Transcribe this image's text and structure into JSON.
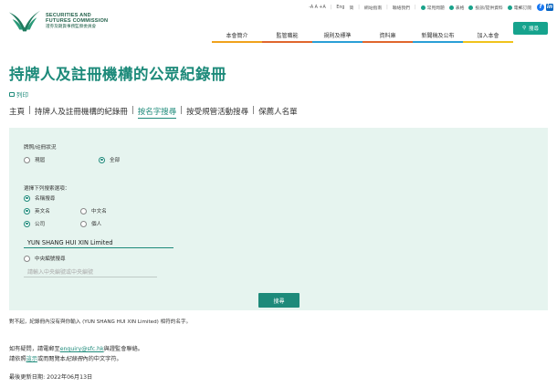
{
  "logo": {
    "en_line1": "SECURITIES AND",
    "en_line2": "FUTURES COMMISSION",
    "zh": "證券及期貨事務監察委員會"
  },
  "utility": {
    "font_sizes": "-A A +A",
    "lang_en": "Eng",
    "lang_sc": "简",
    "sitemap": "網站指南",
    "contact": "聯絡我們",
    "faq": "常見問題",
    "forms": "表格",
    "complaint": "投訴/提供資料",
    "subscribe": "電郵訂閱",
    "social_fb": "f",
    "social_li": "in"
  },
  "search_button": "搜尋",
  "nav": [
    {
      "label": "本會簡介",
      "color": "#f0a21c"
    },
    {
      "label": "監管職能",
      "color": "#e0662d"
    },
    {
      "label": "規則及標準",
      "color": "#2a9fd6"
    },
    {
      "label": "資料庫",
      "color": "#e0662d"
    },
    {
      "label": "新聞稿及公布",
      "color": "#2a9fd6"
    },
    {
      "label": "加入本會",
      "color": "#f0c31c"
    }
  ],
  "page_title": "持牌人及註冊機構的公眾紀錄冊",
  "print_label": "列印",
  "tabs": [
    {
      "label": "主頁"
    },
    {
      "label": "持牌人及註冊機構的紀錄冊"
    },
    {
      "label": "按名字搜尋"
    },
    {
      "label": "按受規管活動搜尋"
    },
    {
      "label": "保薦人名單"
    }
  ],
  "form": {
    "status_label": "牌照/註冊狀況",
    "status_current": "現屆",
    "status_all": "全部",
    "criteria_label": "選擇下列搜索選項：",
    "by_name": "名稱搜尋",
    "english_name": "英文名",
    "chinese_name": "中文名",
    "corporation": "公司",
    "individual": "個人",
    "name_value": "YUN SHANG HUI XIN Limited",
    "by_ce": "中央編號搜尋",
    "ce_placeholder": "請輸入中央編號或中央編號",
    "submit": "搜尋"
  },
  "result_message": "對不起，紀錄冊內沒有與你輸入 (YUN SHANG HUI XIN Limited) 相符的名字。",
  "contact": {
    "line1_pre": "如有疑問，請電郵至",
    "email": "enquiry@sfc.hk",
    "line1_post": "與證監會聯絡。",
    "line2_pre": "請依照",
    "here": "這示",
    "line2_mid": "或而閱覽本",
    "register": "紀錄冊",
    "line2_post": "內的中文字符。"
  },
  "last_updated": "最後更新日期: 2022年06月13日",
  "colors": {
    "accent": "#1d8a7a",
    "panel_bg": "#e6f4ef"
  }
}
